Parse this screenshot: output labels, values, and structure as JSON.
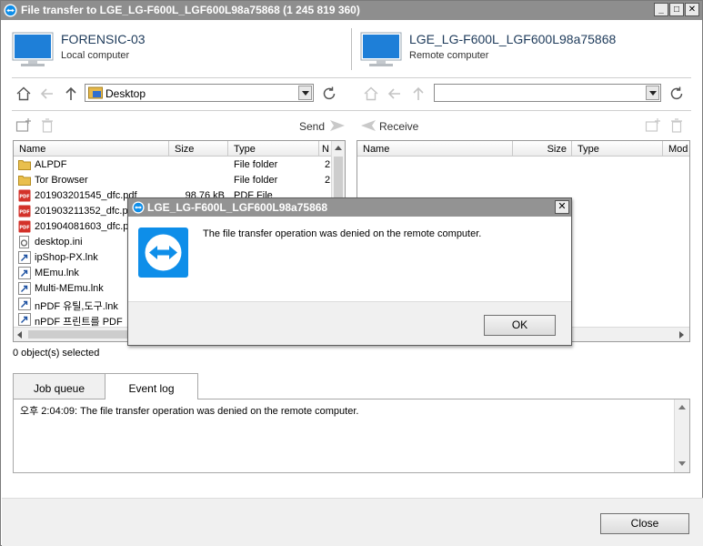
{
  "window": {
    "title": "File transfer to LGE_LG-F600L_LGF600L98a75868 (1 245 819 360)",
    "buttons": {
      "minimize": "_",
      "maximize": "□",
      "close": "✕"
    }
  },
  "local": {
    "name": "FORENSIC-03",
    "subtitle": "Local computer"
  },
  "remote": {
    "name": "LGE_LG-F600L_LGF600L98a75868",
    "subtitle": "Remote computer"
  },
  "left_nav": {
    "path": "Desktop",
    "send_label": "Send"
  },
  "right_nav": {
    "path": "",
    "receive_label": "Receive"
  },
  "left_columns": {
    "name": "Name",
    "size": "Size",
    "type": "Type",
    "modified": "N"
  },
  "right_columns": {
    "name": "Name",
    "size": "Size",
    "type": "Type",
    "modified": "Mod"
  },
  "left_files": [
    {
      "name": "ALPDF",
      "size": "",
      "type": "File folder",
      "mod": "2",
      "icon": "folder-icon"
    },
    {
      "name": "Tor Browser",
      "size": "",
      "type": "File folder",
      "mod": "2",
      "icon": "folder-icon"
    },
    {
      "name": "201903201545_dfc.pdf",
      "size": "98.76 kB",
      "type": "PDF File",
      "mod": "",
      "icon": "pdf-icon"
    },
    {
      "name": "201903211352_dfc.p",
      "size": "",
      "type": "",
      "mod": "",
      "icon": "pdf-icon"
    },
    {
      "name": "201904081603_dfc.p",
      "size": "",
      "type": "",
      "mod": "",
      "icon": "pdf-icon"
    },
    {
      "name": "desktop.ini",
      "size": "",
      "type": "",
      "mod": "",
      "icon": "settings-file-icon"
    },
    {
      "name": "ipShop-PX.lnk",
      "size": "",
      "type": "",
      "mod": "",
      "icon": "shortcut-icon"
    },
    {
      "name": "MEmu.lnk",
      "size": "",
      "type": "",
      "mod": "",
      "icon": "shortcut-icon"
    },
    {
      "name": "Multi-MEmu.lnk",
      "size": "",
      "type": "",
      "mod": "",
      "icon": "shortcut-icon"
    },
    {
      "name": "nPDF 유틸,도구.lnk",
      "size": "",
      "type": "",
      "mod": "",
      "icon": "shortcut-icon"
    },
    {
      "name": "nPDF 프린트를 PDF",
      "size": "",
      "type": "",
      "mod": "",
      "icon": "shortcut-icon"
    }
  ],
  "status": {
    "selected": "0 object(s) selected"
  },
  "tabs": {
    "job_queue": "Job queue",
    "event_log": "Event log"
  },
  "log": {
    "line": "오후 2:04:09: The file transfer operation was denied on the remote computer."
  },
  "buttons": {
    "close": "Close"
  },
  "dialog": {
    "title": "LGE_LG-F600L_LGF600L98a75868",
    "message": "The file transfer operation was denied on the remote computer.",
    "ok": "OK",
    "close_glyph": "✕"
  },
  "colors": {
    "accent": "#0e8ee9",
    "titlebar": "#8e8e8e",
    "monitor": "#1e7fd8"
  }
}
